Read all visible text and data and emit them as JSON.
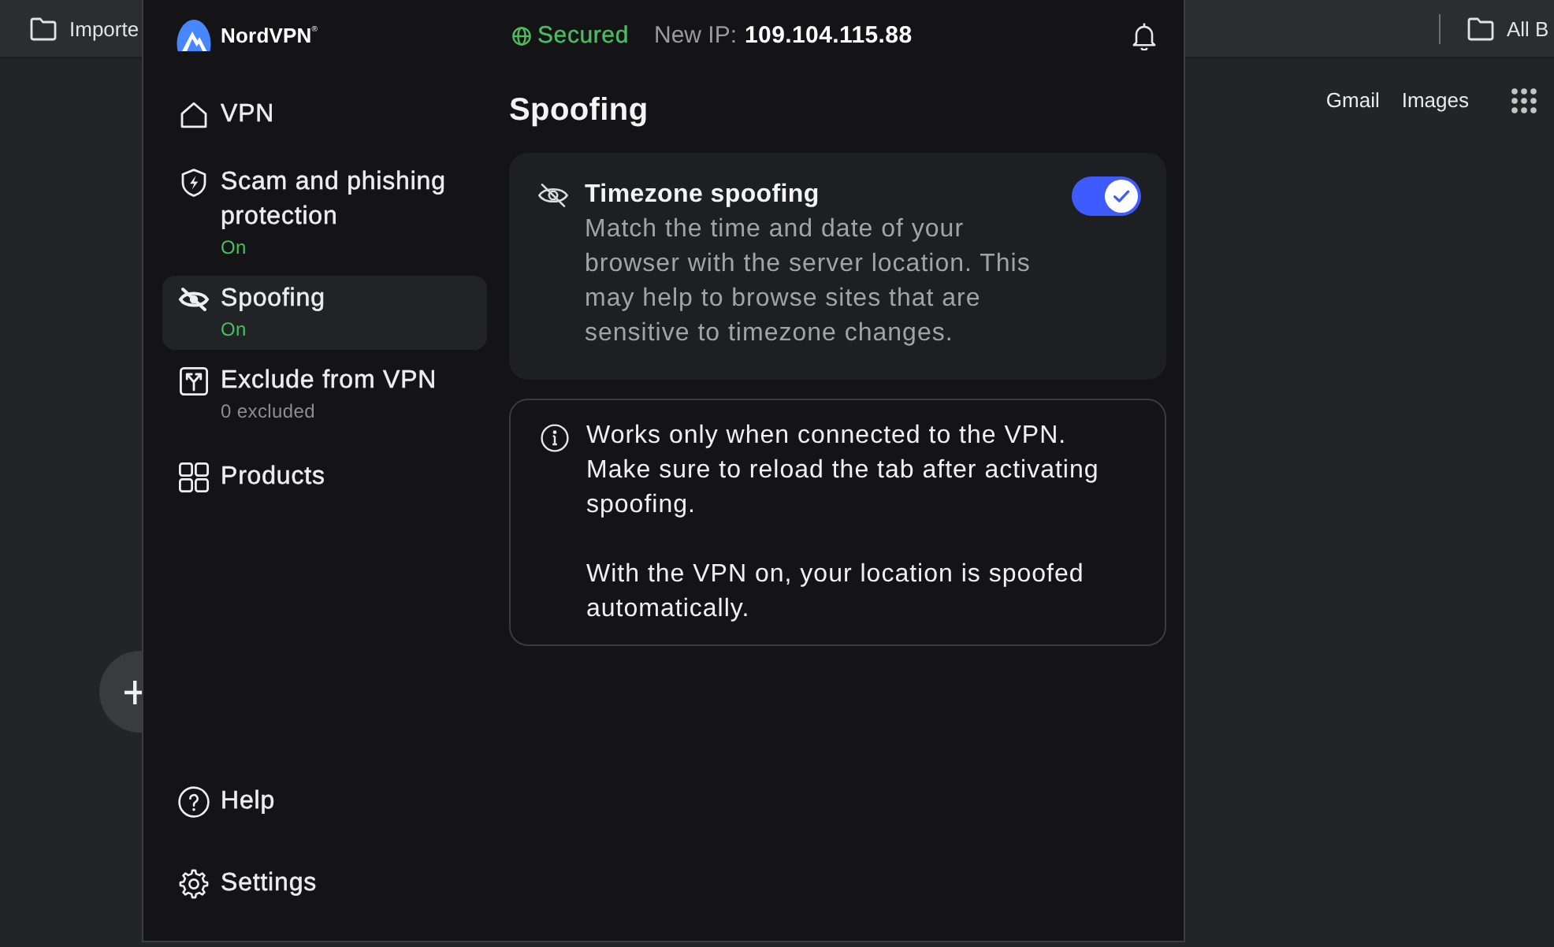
{
  "browser": {
    "bookmarks_bar": {
      "items": [
        {
          "label": "Importe"
        }
      ],
      "all_bookmarks": "All B"
    },
    "links": [
      "Gmail",
      "Images"
    ]
  },
  "popup": {
    "brand": "NordVPN$^{®}$",
    "status": "Secured",
    "ip_label": "New IP:",
    "ip": "109.104.115.88"
  },
  "sidebar": {
    "items": [
      {
        "label": "VPN",
        "selected": false
      },
      {
        "label": "Scam and phishing protection",
        "status": "On",
        "selected": false
      },
      {
        "label": "Spoofing",
        "status": "On",
        "selected": true
      },
      {
        "label": "Exclude from VPN",
        "detail": "0 excluded",
        "selected": false
      },
      {
        "label": "Products",
        "selected": false
      }
    ],
    "footer_items": [
      {
        "label": "Help",
        "selected": false
      },
      {
        "label": "Settings",
        "selected": false
      }
    ]
  },
  "page": {
    "title": "Spoofing",
    "feature": {
      "title": "Timezone spoofing",
      "description": "Match the time and date of your browser with the server location. This may help to browse sites that are sensitive to timezone changes.",
      "on": true
    },
    "notice": {
      "paragraphs": [
        "Works only when connected to the VPN. Make sure to reload the tab after activating spoofing.",
        "With the VPN on, your location is spoofed automatically."
      ]
    }
  }
}
